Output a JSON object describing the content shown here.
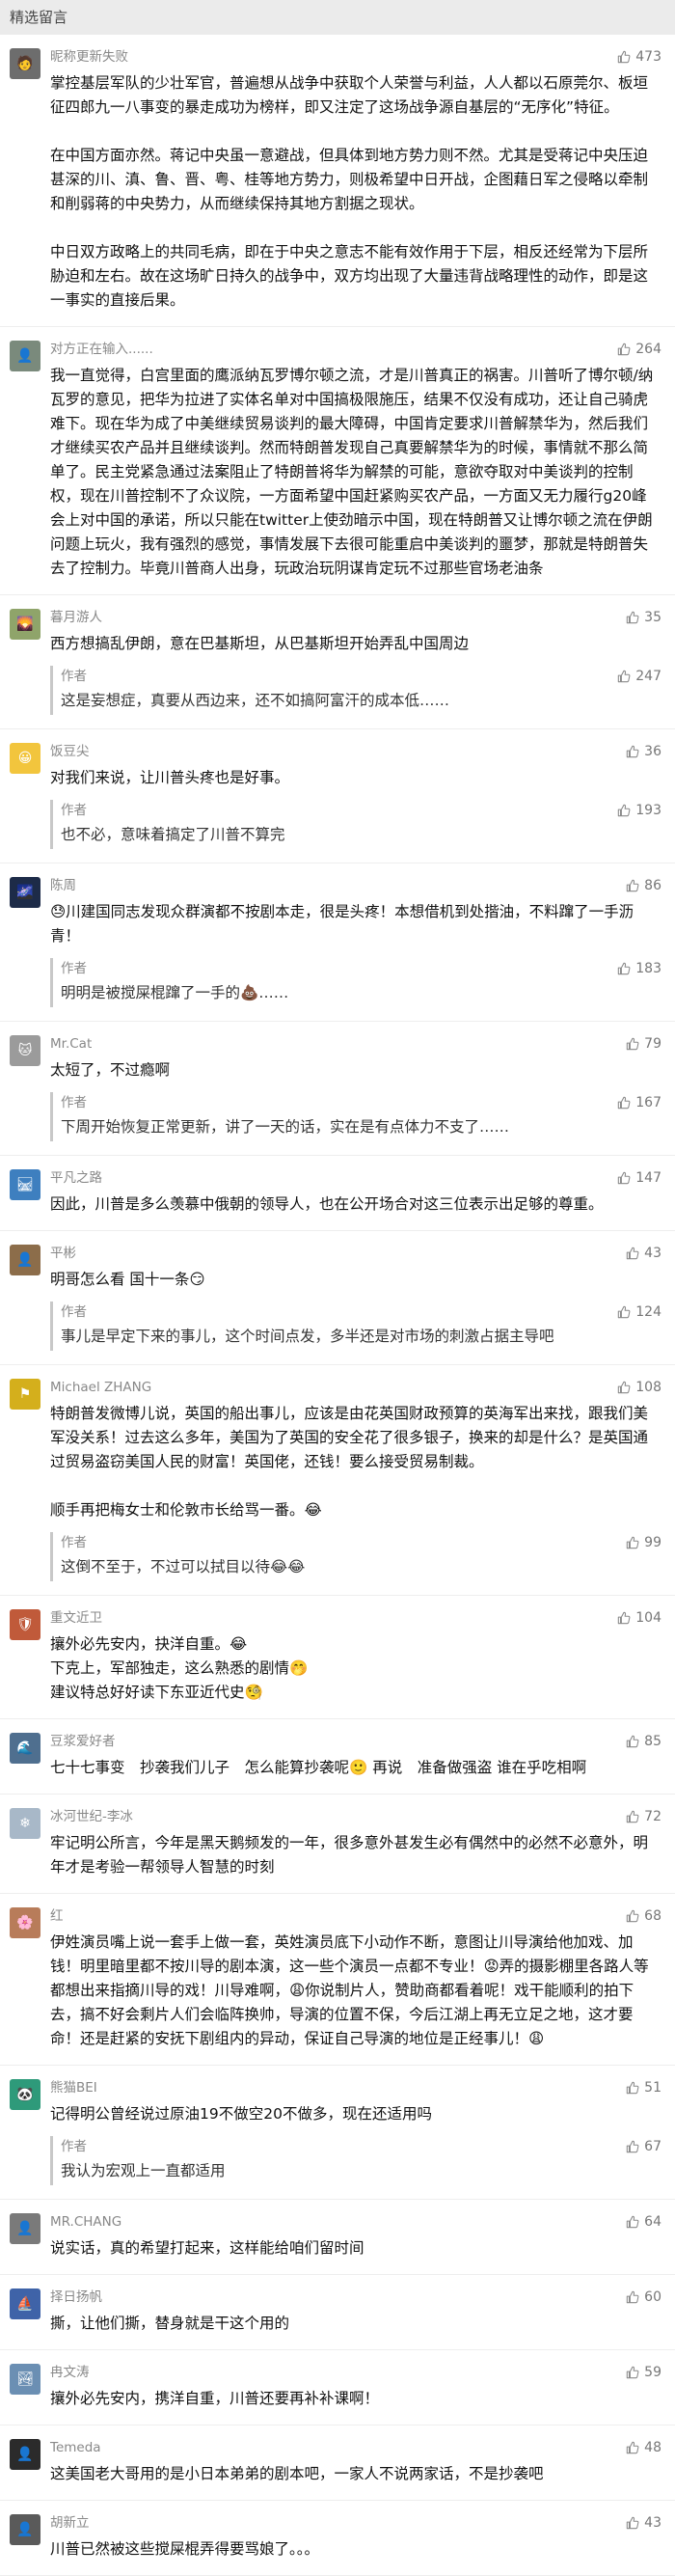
{
  "header": {
    "title": "精选留言"
  },
  "comments": [
    {
      "nick": "昵称更新失败",
      "avatar_color": "#6d6d6d",
      "avatar_glyph": "🧑",
      "likes": "473",
      "content": "掌控基层军队的少壮军官，普遍想从战争中获取个人荣誉与利益，人人都以石原莞尔、板垣征四郎九一八事变的暴走成功为榜样，即又注定了这场战争源自基层的“无序化”特征。\n\n在中国方面亦然。蒋记中央虽一意避战，但具体到地方势力则不然。尤其是受蒋记中央压迫甚深的川、滇、鲁、晋、粤、桂等地方势力，则极希望中日开战，企图藉日军之侵略以牵制和削弱蒋的中央势力，从而继续保持其地方割据之现状。\n\n中日双方政略上的共同毛病，即在于中央之意志不能有效作用于下层，相反还经常为下层所胁迫和左右。故在这场旷日持久的战争中，双方均出现了大量违背战略理性的动作，即是这一事实的直接后果。",
      "reply": null
    },
    {
      "nick": "对方正在输入......",
      "avatar_color": "#7a8a7c",
      "avatar_glyph": "👤",
      "likes": "264",
      "content": "我一直觉得，白宫里面的鹰派纳瓦罗博尔顿之流，才是川普真正的祸害。川普听了博尔顿/纳瓦罗的意见，把华为拉进了实体名单对中国搞极限施压，结果不仅没有成功，还让自己骑虎难下。现在华为成了中美继续贸易谈判的最大障碍，中国肯定要求川普解禁华为，然后我们才继续买农产品并且继续谈判。然而特朗普发现自己真要解禁华为的时候，事情就不那么简单了。民主党紧急通过法案阻止了特朗普将华为解禁的可能，意欲夺取对中美谈判的控制权，现在川普控制不了众议院，一方面希望中国赶紧购买农产品，一方面又无力履行g20峰会上对中国的承诺，所以只能在twitter上使劲暗示中国，现在特朗普又让博尔顿之流在伊朗问题上玩火，我有强烈的感觉，事情发展下去很可能重启中美谈判的噩梦，那就是特朗普失去了控制力。毕竟川普商人出身，玩政治玩阴谋肯定玩不过那些官场老油条",
      "reply": null
    },
    {
      "nick": "暮月游人",
      "avatar_color": "#8fa46a",
      "avatar_glyph": "🌄",
      "likes": "35",
      "content": "西方想搞乱伊朗，意在巴基斯坦，从巴基斯坦开始弄乱中国周边",
      "reply": {
        "author": "作者",
        "likes": "247",
        "content": "这是妄想症，真要从西边来，还不如搞阿富汗的成本低……"
      }
    },
    {
      "nick": "饭豆尖",
      "avatar_color": "#f2c53d",
      "avatar_glyph": "😀",
      "likes": "36",
      "content": "对我们来说，让川普头疼也是好事。",
      "reply": {
        "author": "作者",
        "likes": "193",
        "content": "也不必，意味着搞定了川普不算完"
      }
    },
    {
      "nick": "陈周",
      "avatar_color": "#1d2b48",
      "avatar_glyph": "🌌",
      "likes": "86",
      "content": "😓川建国同志发现众群演都不按剧本走，很是头疼！本想借机到处揩油，不料蹿了一手沥青！",
      "reply": {
        "author": "作者",
        "likes": "183",
        "content": "明明是被搅屎棍蹿了一手的💩……"
      }
    },
    {
      "nick": "Mr.Cat",
      "avatar_color": "#9b9b9b",
      "avatar_glyph": "🐱",
      "likes": "79",
      "content": "太短了，不过瘾啊",
      "reply": {
        "author": "作者",
        "likes": "167",
        "content": "下周开始恢复正常更新，讲了一天的话，实在是有点体力不支了……"
      }
    },
    {
      "nick": "平凡之路",
      "avatar_color": "#3e7fbf",
      "avatar_glyph": "🛤",
      "likes": "147",
      "content": "因此，川普是多么羡慕中俄朝的领导人，也在公开场合对这三位表示出足够的尊重。",
      "reply": null
    },
    {
      "nick": "平彬",
      "avatar_color": "#8c6d4a",
      "avatar_glyph": "👤",
      "likes": "43",
      "content": "明哥怎么看 国十一条😏",
      "reply": {
        "author": "作者",
        "likes": "124",
        "content": "事儿是早定下来的事儿，这个时间点发，多半还是对市场的刺激占据主导吧"
      }
    },
    {
      "nick": "Michael ZHANG",
      "avatar_color": "#d4af1c",
      "avatar_glyph": "⚑",
      "likes": "108",
      "content": "特朗普发微博儿说，英国的船出事儿，应该是由花英国财政预算的英海军出来找，跟我们美军没关系！过去这么多年，美国为了英国的安全花了很多银子，换来的却是什么？是英国通过贸易盗窃美国人民的财富！英国佬，还钱！要么接受贸易制裁。\n\n顺手再把梅女士和伦敦市长给骂一番。😂",
      "reply": {
        "author": "作者",
        "likes": "99",
        "content": "这倒不至于，不过可以拭目以待😂😂"
      }
    },
    {
      "nick": "重文近卫",
      "avatar_color": "#c05a3a",
      "avatar_glyph": "🛡",
      "likes": "104",
      "content": "攘外必先安内，抉洋自重。😂\n下克上，军部独走，这么熟悉的剧情🤭\n建议特总好好读下东亚近代史🧐",
      "reply": null
    },
    {
      "nick": "豆浆爱好者",
      "avatar_color": "#4f6f8f",
      "avatar_glyph": "🌊",
      "likes": "85",
      "content": "七十七事变　抄袭我们儿子　怎么能算抄袭呢🙂 再说　准备做强盗 谁在乎吃相啊",
      "reply": null
    },
    {
      "nick": "冰河世纪-李冰",
      "avatar_color": "#a8b8c8",
      "avatar_glyph": "❄",
      "likes": "72",
      "content": "牢记明公所言，今年是黑天鹅频发的一年，很多意外甚发生必有偶然中的必然不必意外，明年才是考验一帮领导人智慧的时刻",
      "reply": null
    },
    {
      "nick": "红",
      "avatar_color": "#b87c5a",
      "avatar_glyph": "🌸",
      "likes": "68",
      "content": "伊姓演员嘴上说一套手上做一套，英姓演员底下小动作不断，意图让川导演给他加戏、加钱！明里暗里都不按川导的剧本演，这一些个演员一点都不专业！😡弄的摄影棚里各路人等都想出来指摘川导的戏！川导难啊，😩你说制片人，赞助商都看着呢！戏干能顺利的拍下去，搞不好会剩片人们会临阵换帅，导演的位置不保，今后江湖上再无立足之地，这才要命！还是赶紧的安抚下剧组内的异动，保证自己导演的地位是正经事儿！😩",
      "reply": null
    },
    {
      "nick": "熊猫BEI",
      "avatar_color": "#2e9a7a",
      "avatar_glyph": "🐼",
      "likes": "51",
      "content": "记得明公曾经说过原油19不做空20不做多，现在还适用吗",
      "reply": {
        "author": "作者",
        "likes": "67",
        "content": "我认为宏观上一直都适用"
      }
    },
    {
      "nick": "MR.CHANG",
      "avatar_color": "#7a7a7a",
      "avatar_glyph": "👤",
      "likes": "64",
      "content": "说实话，真的希望打起来，这样能给咱们留时间",
      "reply": null
    },
    {
      "nick": "择日扬帆",
      "avatar_color": "#3f63a8",
      "avatar_glyph": "⛵",
      "likes": "60",
      "content": "撕，让他们撕，替身就是干这个用的",
      "reply": null
    },
    {
      "nick": "冉文涛",
      "avatar_color": "#6b8fb3",
      "avatar_glyph": "🏞",
      "likes": "59",
      "content": "攘外必先安内，携洋自重，川普还要再补补课啊！",
      "reply": null
    },
    {
      "nick": "Temeda",
      "avatar_color": "#2b2b2b",
      "avatar_glyph": "👤",
      "likes": "48",
      "content": "这美国老大哥用的是小日本弟弟的剧本吧，一家人不说两家话，不是抄袭吧",
      "reply": null
    },
    {
      "nick": "胡新立",
      "avatar_color": "#5a5a5a",
      "avatar_glyph": "👤",
      "likes": "43",
      "content": "川普已然被这些搅屎棍弄得要骂娘了。。。",
      "reply": null
    }
  ]
}
